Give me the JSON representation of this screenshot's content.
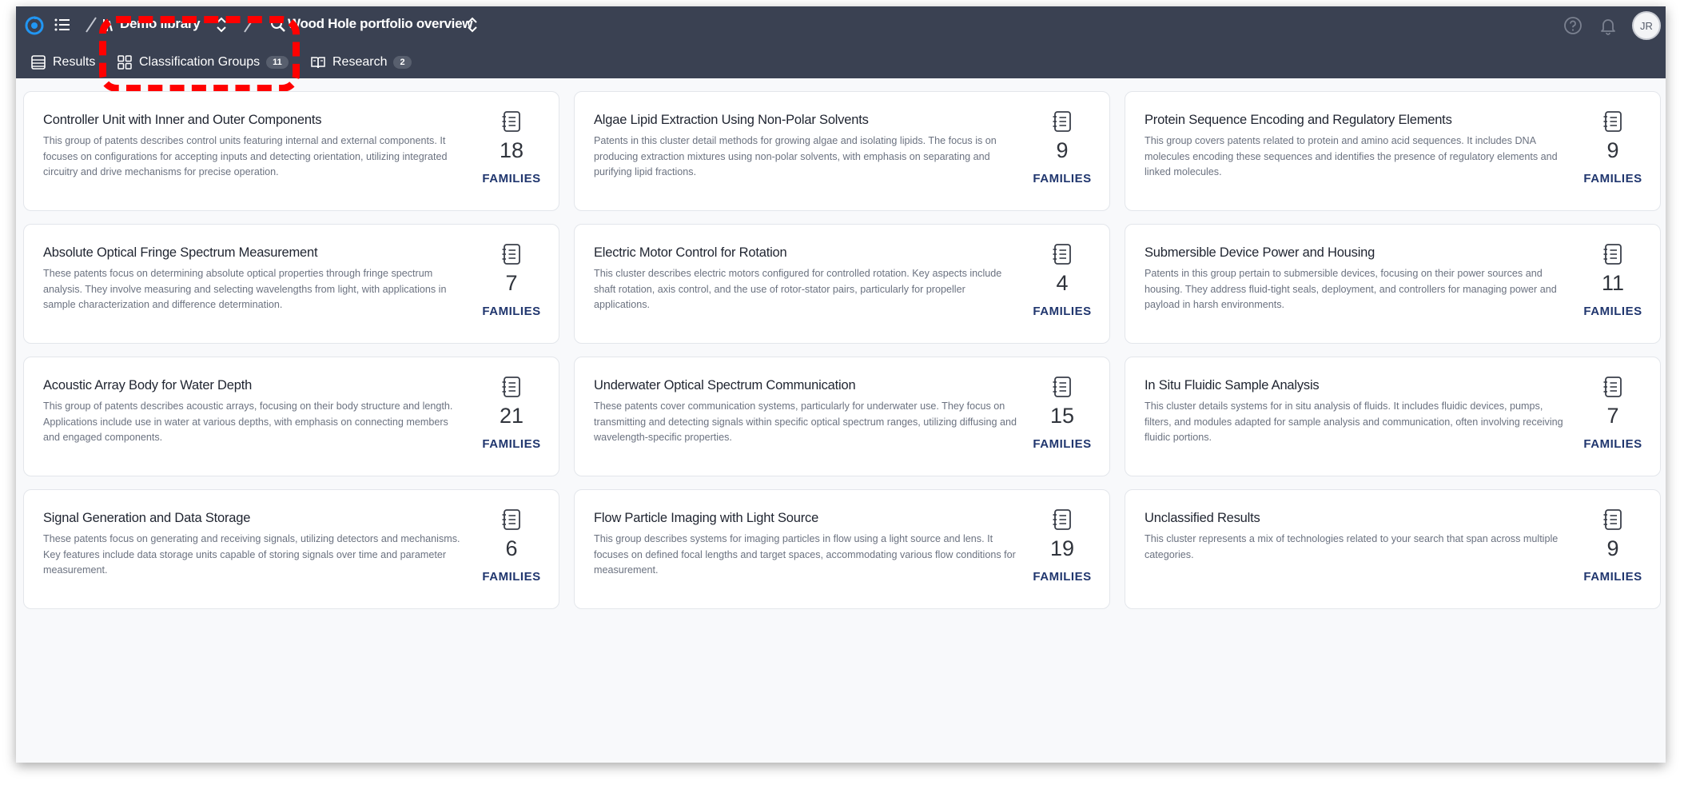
{
  "header": {
    "library_name": "Demo library",
    "project_name": "Wood Hole portfolio overview",
    "avatar_initials": "JR",
    "brand_color": "#2196f3"
  },
  "tabs": [
    {
      "label": "Results",
      "badge": ""
    },
    {
      "label": "Classification Groups",
      "badge": "11"
    },
    {
      "label": "Research",
      "badge": "2"
    }
  ],
  "cards": [
    {
      "title": "Controller Unit with Inner and Outer Components",
      "description": "This group of patents describes control units featuring internal and external components. It focuses on configurations for accepting inputs and detecting orientation, utilizing integrated circuitry and drive mechanisms for precise operation.",
      "count": "18",
      "label": "FAMILIES"
    },
    {
      "title": "Algae Lipid Extraction Using Non-Polar Solvents",
      "description": "Patents in this cluster detail methods for growing algae and isolating lipids. The focus is on producing extraction mixtures using non-polar solvents, with emphasis on separating and purifying lipid fractions.",
      "count": "9",
      "label": "FAMILIES"
    },
    {
      "title": "Protein Sequence Encoding and Regulatory Elements",
      "description": "This group covers patents related to protein and amino acid sequences. It includes DNA molecules encoding these sequences and identifies the presence of regulatory elements and linked molecules.",
      "count": "9",
      "label": "FAMILIES"
    },
    {
      "title": "Absolute Optical Fringe Spectrum Measurement",
      "description": "These patents focus on determining absolute optical properties through fringe spectrum analysis. They involve measuring and selecting wavelengths from light, with applications in sample characterization and difference determination.",
      "count": "7",
      "label": "FAMILIES"
    },
    {
      "title": "Electric Motor Control for Rotation",
      "description": "This cluster describes electric motors configured for controlled rotation. Key aspects include shaft rotation, axis control, and the use of rotor-stator pairs, particularly for propeller applications.",
      "count": "4",
      "label": "FAMILIES"
    },
    {
      "title": "Submersible Device Power and Housing",
      "description": "Patents in this group pertain to submersible devices, focusing on their power sources and housing. They address fluid-tight seals, deployment, and controllers for managing power and payload in harsh environments.",
      "count": "11",
      "label": "FAMILIES"
    },
    {
      "title": "Acoustic Array Body for Water Depth",
      "description": "This group of patents describes acoustic arrays, focusing on their body structure and length. Applications include use in water at various depths, with emphasis on connecting members and engaged components.",
      "count": "21",
      "label": "FAMILIES"
    },
    {
      "title": "Underwater Optical Spectrum Communication",
      "description": "These patents cover communication systems, particularly for underwater use. They focus on transmitting and detecting signals within specific optical spectrum ranges, utilizing diffusing and wavelength-specific properties.",
      "count": "15",
      "label": "FAMILIES"
    },
    {
      "title": "In Situ Fluidic Sample Analysis",
      "description": "This cluster details systems for in situ analysis of fluids. It includes fluidic devices, pumps, filters, and modules adapted for sample analysis and communication, often involving receiving fluidic portions.",
      "count": "7",
      "label": "FAMILIES"
    },
    {
      "title": "Signal Generation and Data Storage",
      "description": "These patents focus on generating and receiving signals, utilizing detectors and mechanisms. Key features include data storage units capable of storing signals over time and parameter measurement.",
      "count": "6",
      "label": "FAMILIES"
    },
    {
      "title": "Flow Particle Imaging with Light Source",
      "description": "This group describes systems for imaging particles in flow using a light source and lens. It focuses on defined focal lengths and target spaces, accommodating various flow conditions for measurement.",
      "count": "19",
      "label": "FAMILIES"
    },
    {
      "title": "Unclassified Results",
      "description": "This cluster represents a mix of technologies related to your search that span across multiple categories.",
      "count": "9",
      "label": "FAMILIES"
    }
  ]
}
